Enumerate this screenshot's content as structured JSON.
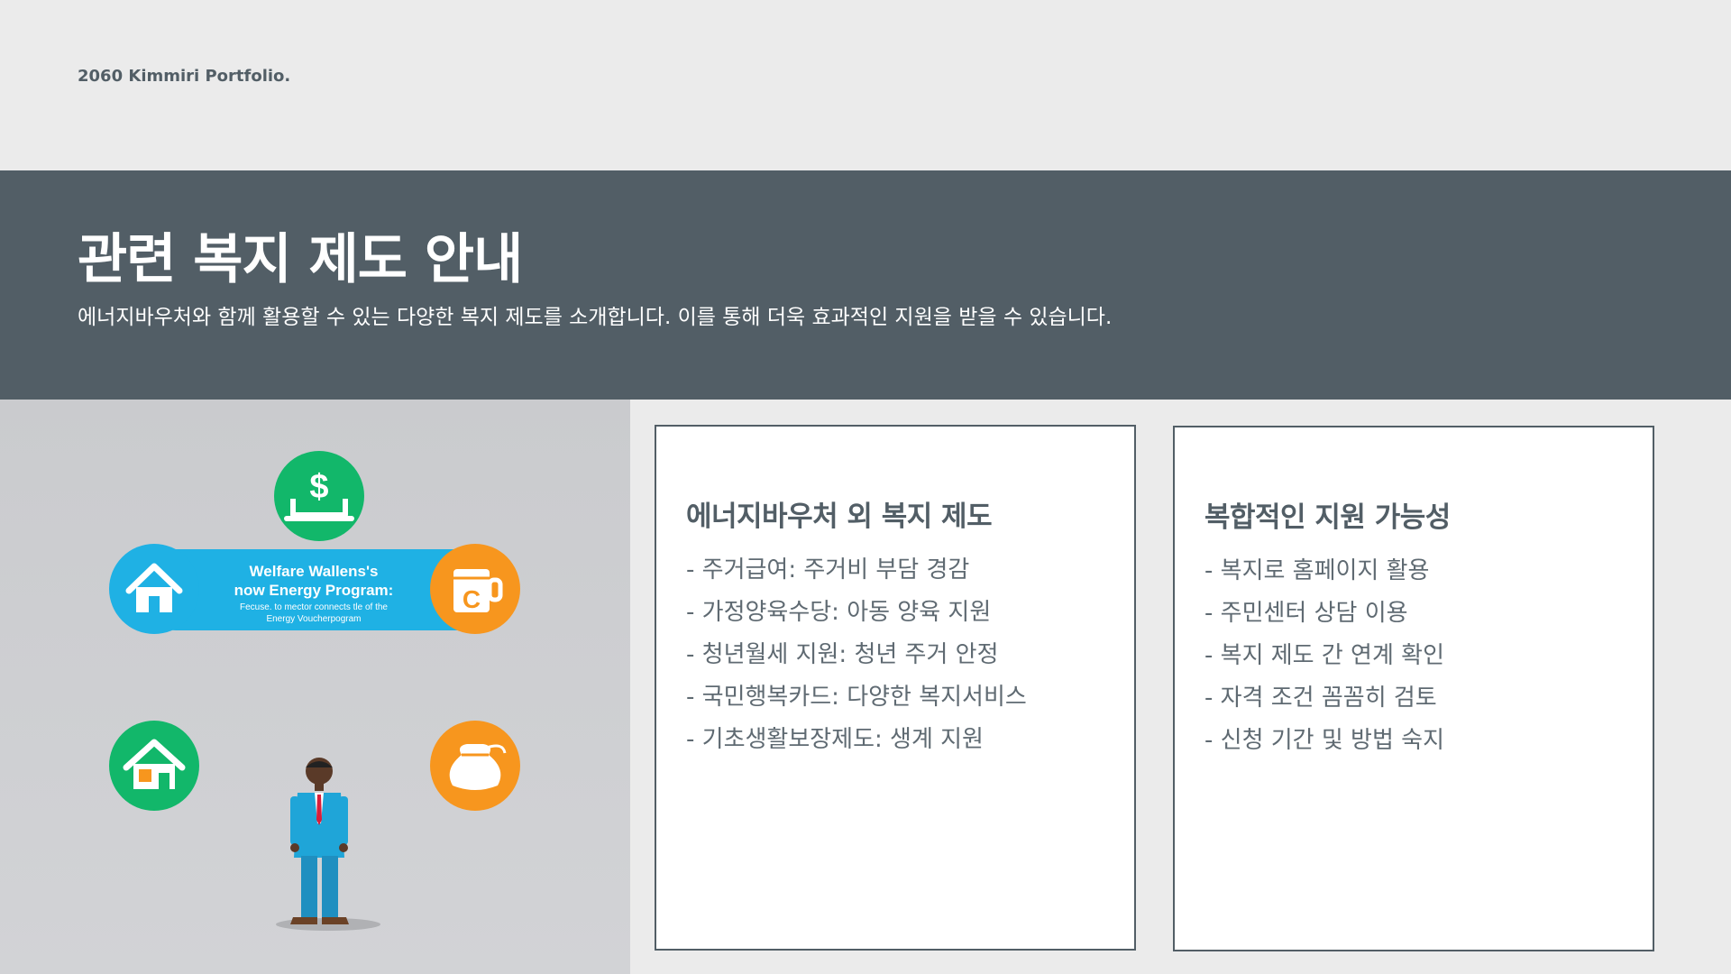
{
  "header": {
    "brand": "2060 Kimmiri Portfolio."
  },
  "banner": {
    "title": "관련 복지 제도 안내",
    "subtitle": "에너지바우처와 함께 활용할 수 있는 다양한 복지 제도를 소개합니다. 이를 통해 더욱 효과적인 지원을 받을 수 있습니다."
  },
  "illustration": {
    "line1": "Welfare Wallens's",
    "line2": "now Energy Program:",
    "line3": "Fecuse. to mector connects tle of the",
    "line4": "Energy Voucherpogram",
    "icons": [
      "dollar-laptop-icon",
      "house-icon",
      "coffee-cup-icon",
      "house-icon",
      "money-bag-icon",
      "person-figure"
    ],
    "colors": {
      "green": "#12b76a",
      "blue": "#1fb1e4",
      "orange": "#f7961e"
    }
  },
  "cards": [
    {
      "title": "에너지바우처 외 복지 제도",
      "items": [
        "- 주거급여: 주거비 부담 경감",
        "- 가정양육수당: 아동 양육 지원",
        "- 청년월세 지원: 청년 주거 안정",
        "- 국민행복카드: 다양한 복지서비스",
        "- 기초생활보장제도: 생계 지원"
      ]
    },
    {
      "title": "복합적인 지원 가능성",
      "items": [
        "- 복지로 홈페이지 활용",
        "- 주민센터 상담 이용",
        "- 복지 제도 간 연계 확인",
        "- 자격 조건 꼼꼼히 검토",
        "- 신청 기간 및 방법 숙지"
      ]
    }
  ],
  "theme": {
    "banner_bg": "#525e66",
    "page_bg": "#ebebeb",
    "card_border": "#525e66"
  }
}
